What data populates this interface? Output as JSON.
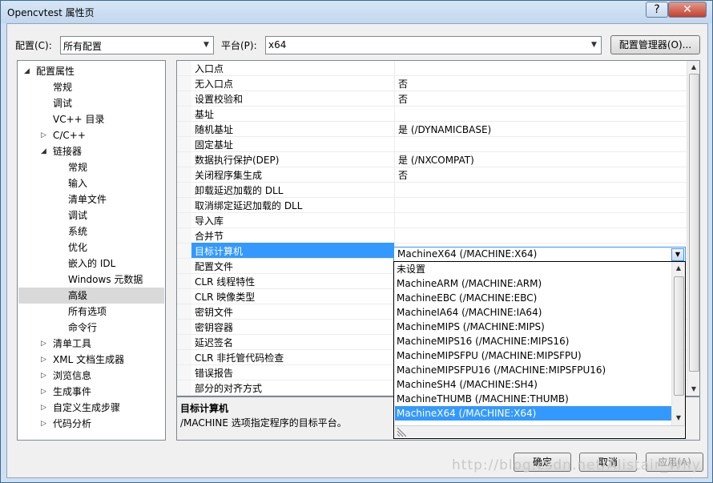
{
  "window": {
    "title": "Opencvtest 属性页",
    "help_glyph": "?",
    "close_glyph": "✕"
  },
  "toolbar": {
    "config_label": "配置(C):",
    "config_value": "所有配置",
    "platform_label": "平台(P):",
    "platform_value": "x64",
    "config_manager_label": "配置管理器(O)..."
  },
  "tree": [
    {
      "label": "配置属性",
      "level": 0,
      "toggle": "◢"
    },
    {
      "label": "常规",
      "level": 1,
      "toggle": ""
    },
    {
      "label": "调试",
      "level": 1,
      "toggle": ""
    },
    {
      "label": "VC++ 目录",
      "level": 1,
      "toggle": ""
    },
    {
      "label": "C/C++",
      "level": 1,
      "toggle": "▷"
    },
    {
      "label": "链接器",
      "level": 1,
      "toggle": "◢"
    },
    {
      "label": "常规",
      "level": 2,
      "toggle": ""
    },
    {
      "label": "输入",
      "level": 2,
      "toggle": ""
    },
    {
      "label": "清单文件",
      "level": 2,
      "toggle": ""
    },
    {
      "label": "调试",
      "level": 2,
      "toggle": ""
    },
    {
      "label": "系统",
      "level": 2,
      "toggle": ""
    },
    {
      "label": "优化",
      "level": 2,
      "toggle": ""
    },
    {
      "label": "嵌入的 IDL",
      "level": 2,
      "toggle": ""
    },
    {
      "label": "Windows 元数据",
      "level": 2,
      "toggle": ""
    },
    {
      "label": "高级",
      "level": 2,
      "toggle": "",
      "selected": true
    },
    {
      "label": "所有选项",
      "level": 2,
      "toggle": ""
    },
    {
      "label": "命令行",
      "level": 2,
      "toggle": ""
    },
    {
      "label": "清单工具",
      "level": 1,
      "toggle": "▷"
    },
    {
      "label": "XML 文档生成器",
      "level": 1,
      "toggle": "▷"
    },
    {
      "label": "浏览信息",
      "level": 1,
      "toggle": "▷"
    },
    {
      "label": "生成事件",
      "level": 1,
      "toggle": "▷"
    },
    {
      "label": "自定义生成步骤",
      "level": 1,
      "toggle": "▷"
    },
    {
      "label": "代码分析",
      "level": 1,
      "toggle": "▷"
    }
  ],
  "properties": [
    {
      "name": "入口点",
      "value": ""
    },
    {
      "name": "无入口点",
      "value": "否"
    },
    {
      "name": "设置校验和",
      "value": "否"
    },
    {
      "name": "基址",
      "value": ""
    },
    {
      "name": "随机基址",
      "value": "是 (/DYNAMICBASE)"
    },
    {
      "name": "固定基址",
      "value": ""
    },
    {
      "name": "数据执行保护(DEP)",
      "value": "是 (/NXCOMPAT)"
    },
    {
      "name": "关闭程序集生成",
      "value": "否"
    },
    {
      "name": "卸载延迟加载的 DLL",
      "value": ""
    },
    {
      "name": "取消绑定延迟加载的 DLL",
      "value": ""
    },
    {
      "name": "导入库",
      "value": ""
    },
    {
      "name": "合并节",
      "value": ""
    },
    {
      "name": "目标计算机",
      "value": "",
      "selected": true
    },
    {
      "name": "配置文件",
      "value": ""
    },
    {
      "name": "CLR 线程特性",
      "value": ""
    },
    {
      "name": "CLR 映像类型",
      "value": ""
    },
    {
      "name": "密钥文件",
      "value": ""
    },
    {
      "name": "密钥容器",
      "value": ""
    },
    {
      "name": "延迟签名",
      "value": ""
    },
    {
      "name": "CLR 非托管代码检查",
      "value": ""
    },
    {
      "name": "错误报告",
      "value": ""
    },
    {
      "name": "部分的对齐方式",
      "value": ""
    }
  ],
  "editor": {
    "value": "MachineX64 (/MACHINE:X64)"
  },
  "dropdown_options": [
    {
      "label": "未设置"
    },
    {
      "label": "MachineARM (/MACHINE:ARM)"
    },
    {
      "label": "MachineEBC (/MACHINE:EBC)"
    },
    {
      "label": "MachineIA64 (/MACHINE:IA64)"
    },
    {
      "label": "MachineMIPS (/MACHINE:MIPS)"
    },
    {
      "label": "MachineMIPS16 (/MACHINE:MIPS16)"
    },
    {
      "label": "MachineMIPSFPU (/MACHINE:MIPSFPU)"
    },
    {
      "label": "MachineMIPSFPU16 (/MACHINE:MIPSFPU16)"
    },
    {
      "label": "MachineSH4 (/MACHINE:SH4)"
    },
    {
      "label": "MachineTHUMB (/MACHINE:THUMB)"
    },
    {
      "label": "MachineX64 (/MACHINE:X64)",
      "selected": true
    }
  ],
  "description": {
    "title": "目标计算机",
    "text": "/MACHINE 选项指定程序的目标平台。"
  },
  "footer": {
    "ok": "确定",
    "cancel": "取消",
    "apply": "应用(A)",
    "watermark": "http://blog.csdn.net/Alistair_Why"
  },
  "colors": {
    "selection": "#3399ff",
    "title_bar": "#c2d7ee",
    "close_button": "#c4402c"
  }
}
